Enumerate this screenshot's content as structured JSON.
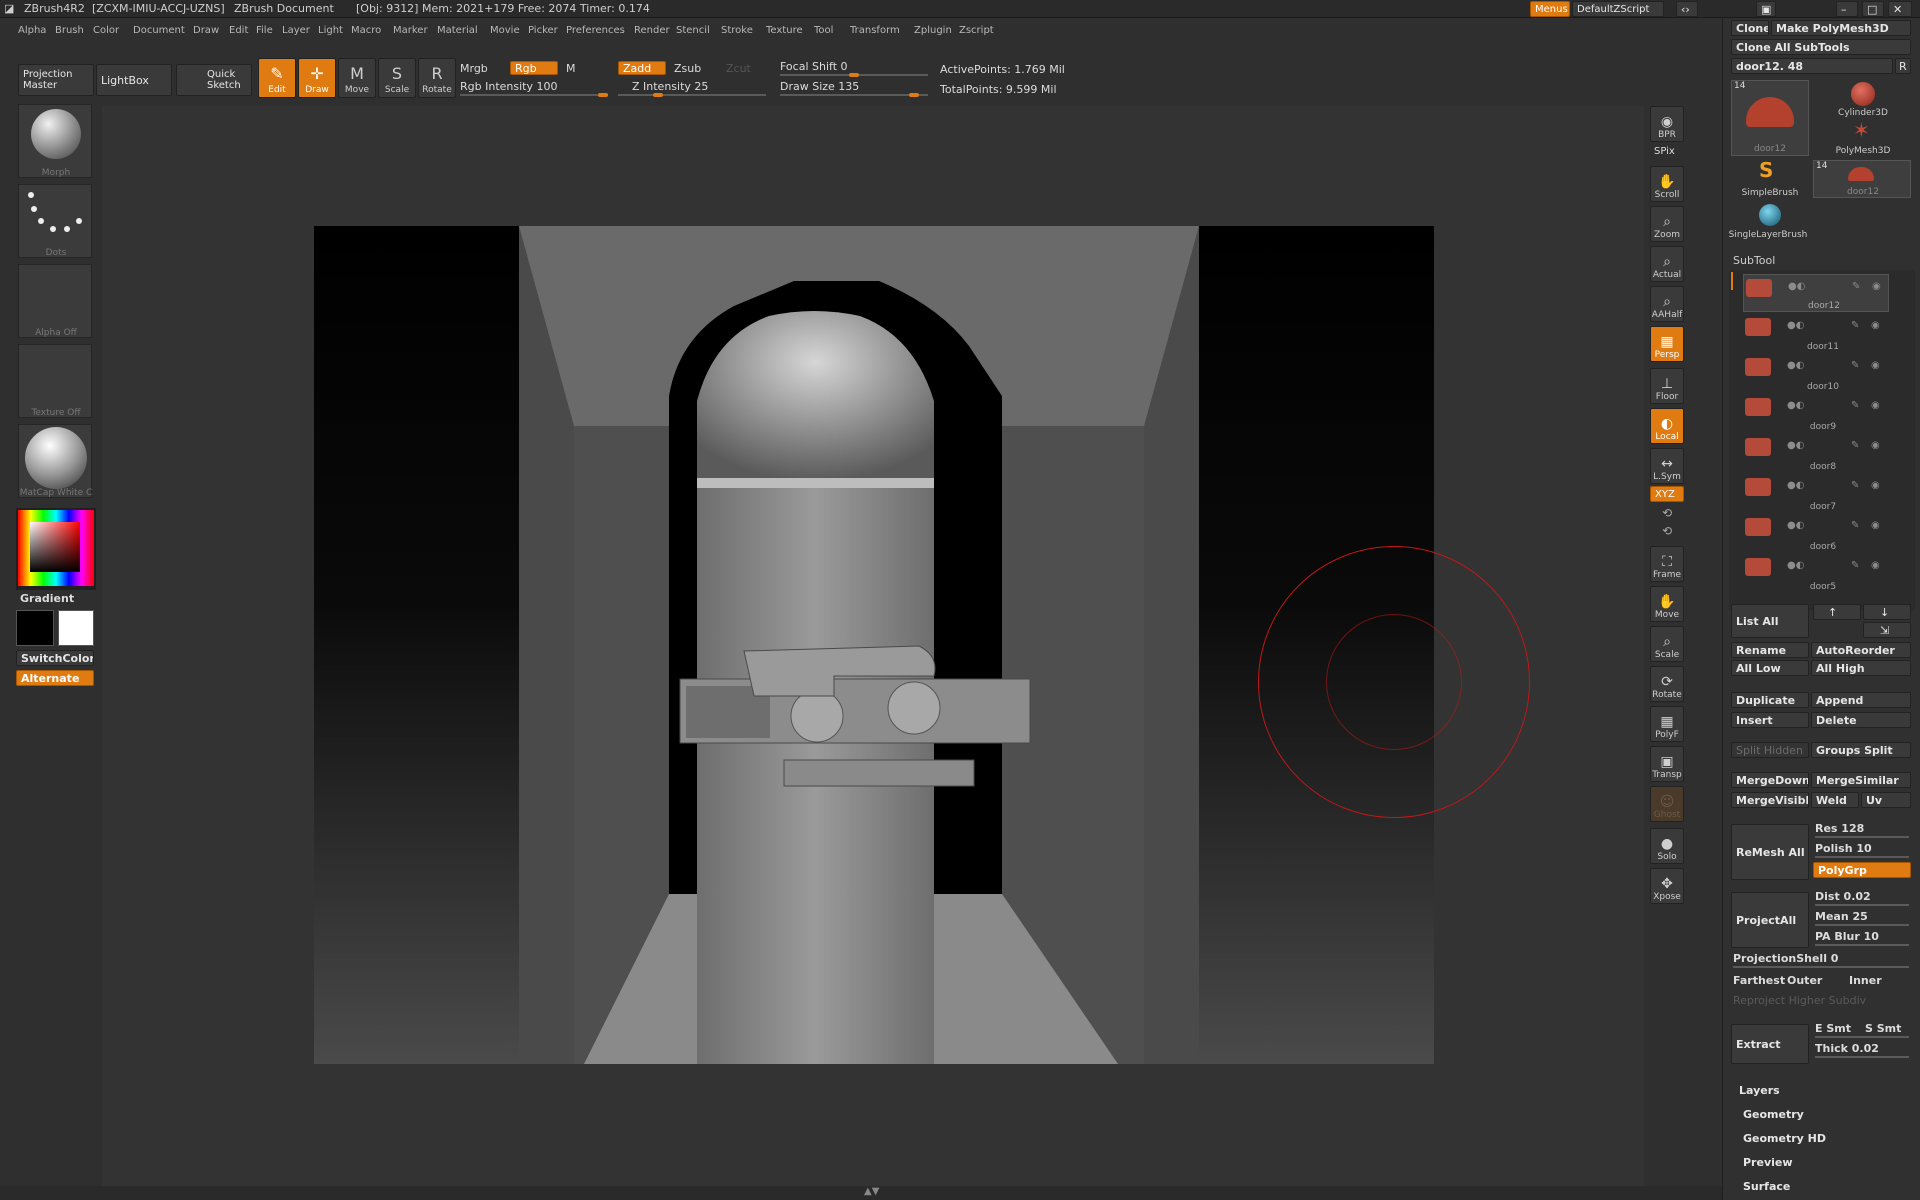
{
  "titlebar": {
    "app": "ZBrush4R2",
    "license": "[ZCXM-IMIU-ACCJ-UZNS]",
    "doc": "ZBrush Document",
    "stats": "[Obj: 9312] Mem: 2021+179 Free: 2074 Timer: 0.174",
    "menus_btn": "Menus",
    "script_btn": "DefaultZScript"
  },
  "menubar": [
    "Alpha",
    "Brush",
    "Color",
    "Document",
    "Draw",
    "Edit",
    "File",
    "Layer",
    "Light",
    "Macro",
    "Marker",
    "Material",
    "Movie",
    "Picker",
    "Preferences",
    "Render",
    "Stencil",
    "Stroke",
    "Texture",
    "Tool",
    "Transform",
    "Zplugin",
    "Zscript"
  ],
  "toolbar": {
    "projection_master": "Projection Master",
    "lightbox": "LightBox",
    "quick_sketch": "Quick Sketch",
    "edit": "Edit",
    "draw": "Draw",
    "move": "Move",
    "scale": "Scale",
    "rotate": "Rotate",
    "mrgb": "Mrgb",
    "rgb": "Rgb",
    "m": "M",
    "zadd": "Zadd",
    "zsub": "Zsub",
    "zcut": "Zcut",
    "rgb_intensity": "Rgb Intensity 100",
    "z_intensity": "Z Intensity 25",
    "focal_shift": "Focal Shift 0",
    "draw_size": "Draw Size 135",
    "active_points": "ActivePoints: 1.769 Mil",
    "total_points": "TotalPoints: 9.599 Mil",
    "rgb_intensity_value": 100,
    "z_intensity_value": 25,
    "focal_shift_value": 0,
    "draw_size_value": 135
  },
  "leftshelf": {
    "brush": "Morph",
    "stroke": "Dots",
    "alpha": "Alpha Off",
    "texture": "Texture Off",
    "material": "MatCap White C",
    "gradient": "Gradient",
    "switch_color": "SwitchColor",
    "alternate": "Alternate"
  },
  "rightbar": [
    "BPR",
    "SPix",
    "Scroll",
    "Zoom",
    "Actual",
    "AAHalf",
    "Persp",
    "Floor",
    "Local",
    "L.Sym",
    "XYZ",
    "Frame",
    "Move",
    "Scale",
    "Rotate",
    "PolyF",
    "Transp",
    "Ghost",
    "Solo",
    "Xpose"
  ],
  "rightpanel": {
    "clone": "Clone",
    "make_polymesh": "Make PolyMesh3D",
    "clone_all": "Clone All SubTools",
    "tool_name": "door12. 48",
    "r_btn": "R",
    "tools": [
      {
        "name": "door12",
        "count": "14"
      },
      {
        "name": "Cylinder3D",
        "count": ""
      },
      {
        "name": "PolyMesh3D",
        "count": ""
      },
      {
        "name": "SimpleBrush",
        "count": ""
      },
      {
        "name": "door12",
        "count": "14"
      },
      {
        "name": "SingleLayerBrush",
        "count": ""
      }
    ],
    "subtool_title": "SubTool",
    "subtools": [
      "door12",
      "door11",
      "door10",
      "door9",
      "door8",
      "door7",
      "door6",
      "door5"
    ],
    "list_all": "List All",
    "rename": "Rename",
    "autoreorder": "AutoReorder",
    "all_low": "All Low",
    "all_high": "All High",
    "duplicate": "Duplicate",
    "append": "Append",
    "insert": "Insert",
    "delete": "Delete",
    "split_hidden": "Split Hidden",
    "groups_split": "Groups Split",
    "mergedown": "MergeDown",
    "mergesimilar": "MergeSimilar",
    "mergevisible": "MergeVisible",
    "weld": "Weld",
    "uv": "Uv",
    "remesh_all": "ReMesh All",
    "res": "Res 128",
    "polish": "Polish 10",
    "polygrp": "PolyGrp",
    "projectall": "ProjectAll",
    "dist": "Dist 0.02",
    "mean": "Mean 25",
    "pa_blur": "PA Blur 10",
    "projectionshell": "ProjectionShell 0",
    "farthest": "Farthest",
    "outer": "Outer",
    "inner": "Inner",
    "reproject": "Reproject Higher Subdiv",
    "extract": "Extract",
    "e_smt": "E Smt",
    "s_smt": "S Smt",
    "thick": "Thick 0.02",
    "sections": [
      "Layers",
      "Geometry",
      "Geometry HD",
      "Preview",
      "Surface"
    ]
  },
  "colors": {
    "accent": "#e07b12",
    "brush_circle": "#c01818"
  }
}
